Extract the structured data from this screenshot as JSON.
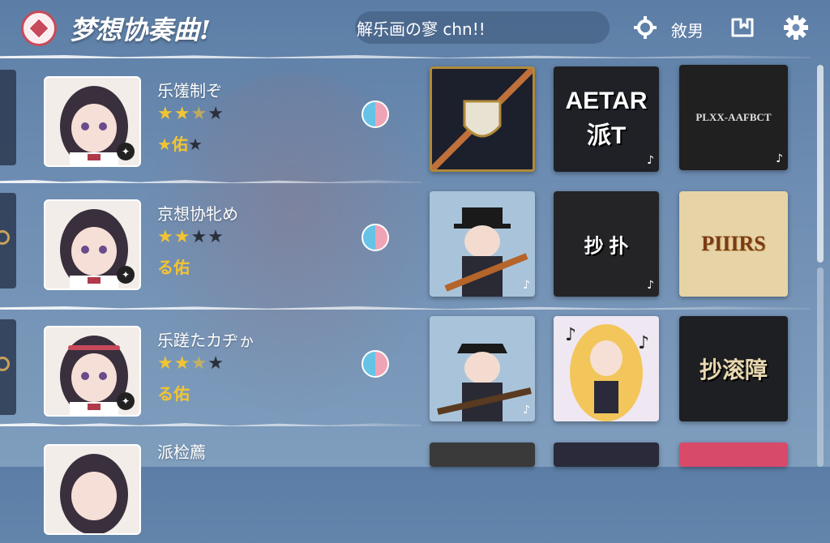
{
  "header": {
    "title": "梦想协奏曲!",
    "search_text": "解乐画の寥 chn!!",
    "tab_label": "敘男",
    "icons": [
      "diamond-logo-icon",
      "crosshair-icon",
      "bookmark-icon",
      "gear-icon"
    ]
  },
  "songs": [
    {
      "name": "乐馐制ぞ",
      "stars": 2.5,
      "stars_max": 4,
      "rank": "★佑",
      "rank_extra": "★"
    },
    {
      "name": "京想协牝め",
      "stars": 2,
      "stars_max": 4,
      "rank": "る佑",
      "rank_extra": ""
    },
    {
      "name": "乐蹉たカヂゕ",
      "stars": 2.5,
      "stars_max": 4,
      "rank": "る佑",
      "rank_extra": ""
    },
    {
      "name": "派检薦",
      "stars": 0,
      "stars_max": 0,
      "rank": "",
      "rank_extra": ""
    }
  ],
  "albums": [
    {
      "label": ""
    },
    {
      "label": "AETAR 派T"
    },
    {
      "label": "PLXX-AAFBCT"
    },
    {
      "label": ""
    },
    {
      "label": "抄 扑"
    },
    {
      "label": "PIIIRS"
    },
    {
      "label": ""
    },
    {
      "label": ""
    },
    {
      "label": "抄滚障"
    }
  ],
  "colors": {
    "accent": "#c84a5a",
    "star": "#f2c432",
    "background": "#6e8db2"
  }
}
